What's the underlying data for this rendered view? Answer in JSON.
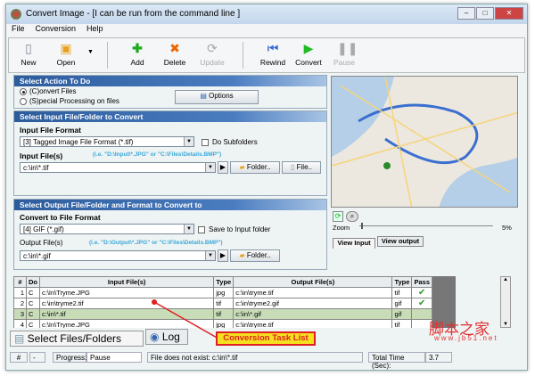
{
  "window": {
    "title": "Convert Image - [I can be run from the command line ]"
  },
  "menu": [
    "File",
    "Conversion",
    "Help"
  ],
  "toolbar": {
    "new": "New",
    "open": "Open",
    "add": "Add",
    "delete": "Delete",
    "update": "Update",
    "rewind": "Rewind",
    "convert": "Convert",
    "pause": "Pause"
  },
  "action": {
    "header": "Select Action To Do",
    "convert": "(C)onvert Files",
    "special": "(S)pecial Processing on files",
    "options": "Options"
  },
  "input": {
    "header": "Select Input File/Folder to Convert",
    "format_label": "Input File Format",
    "format_value": "[3] Tagged Image File Format (*.tif)",
    "subfolders": "Do Subfolders",
    "files_label": "Input File(s)",
    "hint": "(i.e. \"D:\\Input\\*.JPG\"  or \"C:\\Files\\Details.BMP\")",
    "files_value": "c:\\in\\*.tif",
    "folder": "Folder..",
    "file": "File.."
  },
  "output": {
    "header": "Select Output File/Folder and Format to Convert to",
    "format_label": "Convert to File Format",
    "format_value": "[4] GIF (*.gif)",
    "save_input": "Save to Input folder",
    "files_label": "Output File(s)",
    "hint": "(i.e. \"D:\\Output\\*.JPG\"  or \"C:\\Files\\Details.BMP\")",
    "files_value": "c:\\in\\*.gif",
    "folder": "Folder.."
  },
  "preview": {
    "zoom_label": "Zoom",
    "zoom_value": "5%",
    "tab_input": "View Input",
    "tab_output": "View output"
  },
  "table": {
    "headers": [
      "#",
      "Do",
      "Input File(s)",
      "Type",
      "Output File(s)",
      "Type",
      "Pass"
    ],
    "rows": [
      [
        "1",
        "C",
        "c:\\In\\Tryme.JPG",
        "jpg",
        "c:\\in\\tryme.tif",
        "tif",
        "✔"
      ],
      [
        "2",
        "C",
        "c:\\in\\tryme2.tif",
        "tif",
        "c:\\in\\tryme2.gif",
        "gif",
        "✔"
      ],
      [
        "3",
        "C",
        "c:\\in\\*.tif",
        "tif",
        "c:\\in\\*.gif",
        "gif",
        ""
      ],
      [
        "4",
        "C",
        "c:\\In\\Tryme.JPG",
        "jpg",
        "c:\\in\\tryme.tif",
        "tif",
        ""
      ]
    ]
  },
  "tabs": {
    "files": "Select Files/Folders",
    "log": "Log"
  },
  "callout": "Conversion Task List",
  "watermark": {
    "cn": "脚本之家",
    "url": "www.jb51.net"
  },
  "status": {
    "hash": "#",
    "dash": "-",
    "progress_label": "Progress:",
    "progress_value": "Pause",
    "message": "File does not exist: c:\\in\\*.tif",
    "time_label": "Total Time (Sec):",
    "time_value": "3.7"
  }
}
